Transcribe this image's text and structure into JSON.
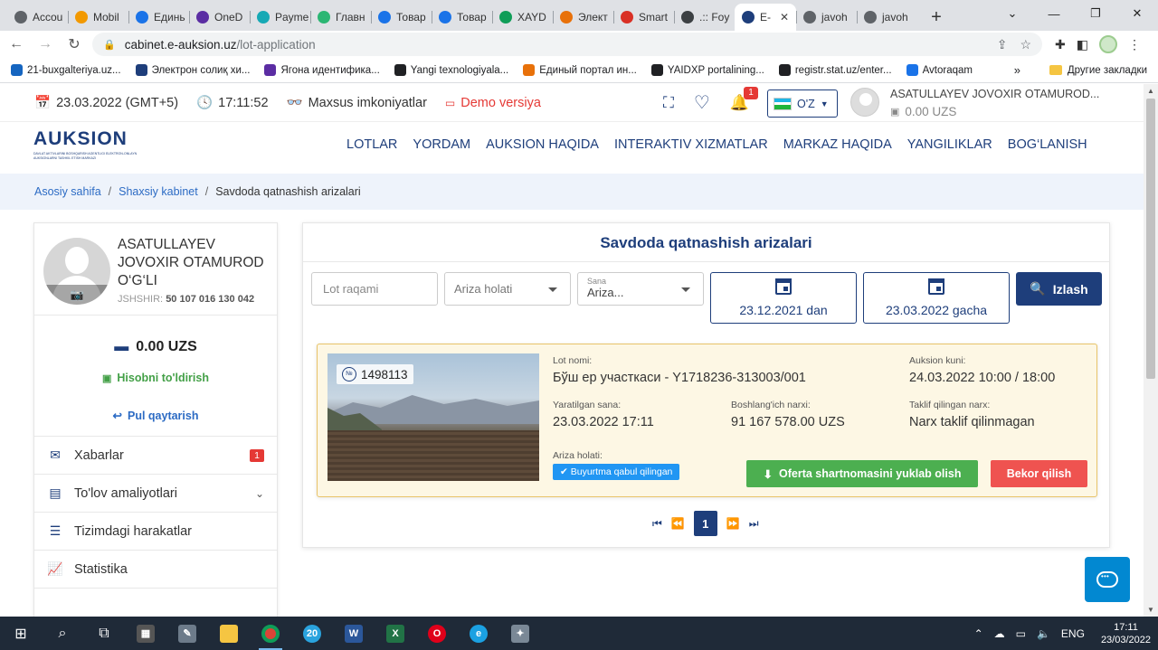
{
  "browser": {
    "tabs": [
      {
        "label": "Accou",
        "color": "#5f6368"
      },
      {
        "label": "Mobil",
        "color": "#f29900"
      },
      {
        "label": "Единь",
        "color": "#1a73e8"
      },
      {
        "label": "OneD",
        "color": "#5b2da3"
      },
      {
        "label": "Payme",
        "color": "#16a9b5"
      },
      {
        "label": "Главн",
        "color": "#2bb673"
      },
      {
        "label": "Товар",
        "color": "#1a73e8"
      },
      {
        "label": "Товар",
        "color": "#1a73e8"
      },
      {
        "label": "XAYD",
        "color": "#0f9d58"
      },
      {
        "label": "Элект",
        "color": "#e8710a"
      },
      {
        "label": "Smart",
        "color": "#d93025"
      },
      {
        "label": ".:: Foy",
        "color": "#3c4043"
      },
      {
        "label": "E-",
        "color": "#1e3e7b",
        "active": true
      },
      {
        "label": "javoh",
        "color": "#5f6368"
      },
      {
        "label": "javoh",
        "color": "#5f6368"
      }
    ],
    "new_tab": "+",
    "url_host": "cabinet.e-auksion.uz",
    "url_path": "/lot-application",
    "bookmarks": [
      {
        "label": "21-buxgalteriya.uz...",
        "color": "#1565c0"
      },
      {
        "label": "Электрон солиқ хи...",
        "color": "#1e3e7b"
      },
      {
        "label": "Ягона идентифика...",
        "color": "#5b2da3"
      },
      {
        "label": "Yangi texnologiyala...",
        "color": "#202124"
      },
      {
        "label": "Единый портал ин...",
        "color": "#e8710a"
      },
      {
        "label": "YAIDXP portalining...",
        "color": "#202124"
      },
      {
        "label": "registr.stat.uz/enter...",
        "color": "#202124"
      },
      {
        "label": "Avtoraqam",
        "color": "#1a73e8"
      }
    ],
    "bookmarks_more": "»",
    "bookmarks_folder": "Другие закладки"
  },
  "topinfo": {
    "date": "23.03.2022 (GMT+5)",
    "time": "17:11:52",
    "accessibility": "Maxsus imkoniyatlar",
    "demo": "Demo versiya",
    "notif_count": "1",
    "lang": "O'Z",
    "user_name": "ASATULLAYEV JOVOXIR OTAMUROD...",
    "user_balance": "0.00 UZS"
  },
  "logo": {
    "word": "AUKSION",
    "sub": "DAVLAT AKTIVLARINI BOSHQARISH AGENTLIGI ELEKTRON-ONLAYN AUKSIONLARNI TASHKIL ETISH MARKAZI"
  },
  "nav": [
    "LOTLAR",
    "YORDAM",
    "AUKSION HAQIDA",
    "INTERAKTIV XIZMATLAR",
    "MARKAZ HAQIDA",
    "YANGILIKLAR",
    "BOG‘LANISH"
  ],
  "breadcrumb": {
    "home": "Asosiy sahifa",
    "cabinet": "Shaxsiy kabinet",
    "current": "Savdoda qatnashish arizalari",
    "sep": "/"
  },
  "sidebar": {
    "name": "ASATULLAYEV JOVOXIR OTAMUROD O‘G‘LI",
    "jshshir_label": "JSHSHIR:",
    "jshshir": "50 107 016 130 042",
    "balance": "0.00 UZS",
    "refill": "Hisobni to'ldirish",
    "refund": "Pul qaytarish",
    "menu": [
      {
        "label": "Xabarlar",
        "icon": "envelope-icon",
        "count": "1"
      },
      {
        "label": "To'lov amaliyotlari",
        "icon": "wallet-icon",
        "chevron": true
      },
      {
        "label": "Tizimdagi harakatlar",
        "icon": "list-icon"
      },
      {
        "label": "Statistika",
        "icon": "chart-icon"
      }
    ]
  },
  "main": {
    "title": "Savdoda qatnashish arizalari",
    "filters": {
      "lot_placeholder": "Lot raqami",
      "status_placeholder": "Ariza holati",
      "date_label": "Sana",
      "date_value": "Ariza...",
      "from": "23.12.2021 dan",
      "to": "23.03.2022 gacha",
      "search": "Izlash"
    },
    "lot": {
      "number": "1498113",
      "name_label": "Lot nomi:",
      "name": "Бўш ер участкаси - Y1718236-313003/001",
      "auction_label": "Auksion kuni:",
      "auction": "24.03.2022 10:00 / 18:00",
      "created_label": "Yaratilgan sana:",
      "created": "23.03.2022 17:11",
      "start_price_label": "Boshlang'ich narxi:",
      "start_price": "91 167 578.00 UZS",
      "offer_label": "Taklif qilingan narx:",
      "offer": "Narx taklif qilinmagan",
      "status_label": "Ariza holati:",
      "status": "Buyurtma qabul qilingan",
      "download": "Oferta shartnomasini yuklab olish",
      "cancel": "Bekor qilish"
    },
    "pager": {
      "current": "1"
    }
  },
  "taskbar": {
    "lang": "ENG",
    "time": "17:11",
    "date": "23/03/2022",
    "badge": "20"
  }
}
